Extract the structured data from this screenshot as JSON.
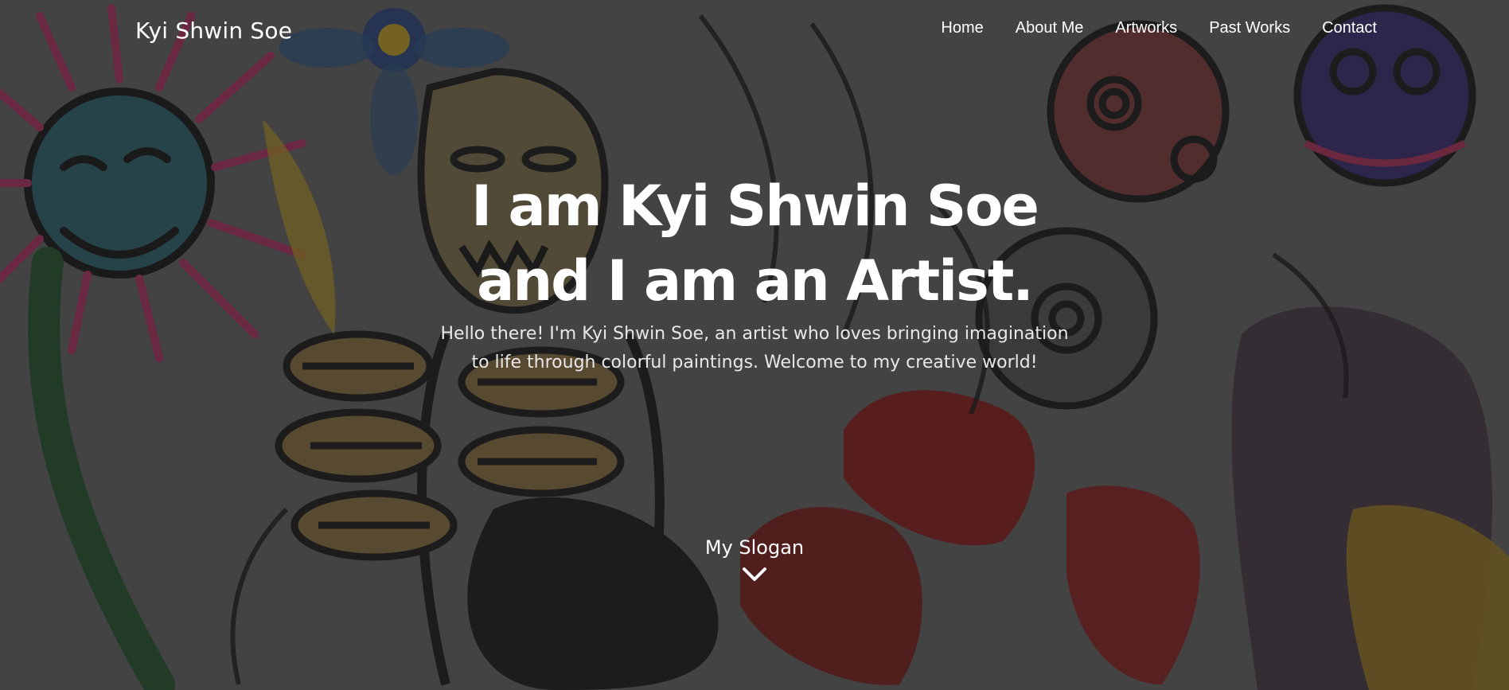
{
  "brand": {
    "name": "Kyi Shwin Soe"
  },
  "nav": {
    "items": [
      {
        "label": "Home"
      },
      {
        "label": "About Me"
      },
      {
        "label": "Artworks"
      },
      {
        "label": "Past Works"
      },
      {
        "label": "Contact"
      }
    ]
  },
  "hero": {
    "headline_line1": "I am Kyi Shwin Soe",
    "headline_line2": "and I am an Artist.",
    "intro": "Hello there! I'm Kyi Shwin Soe, an artist who loves bringing imagination to life through colorful paintings. Welcome to my creative world!",
    "slogan": "My Slogan",
    "scroll_icon": "chevron-down-icon"
  },
  "colors": {
    "text": "#ffffff",
    "overlay": "#232323"
  }
}
